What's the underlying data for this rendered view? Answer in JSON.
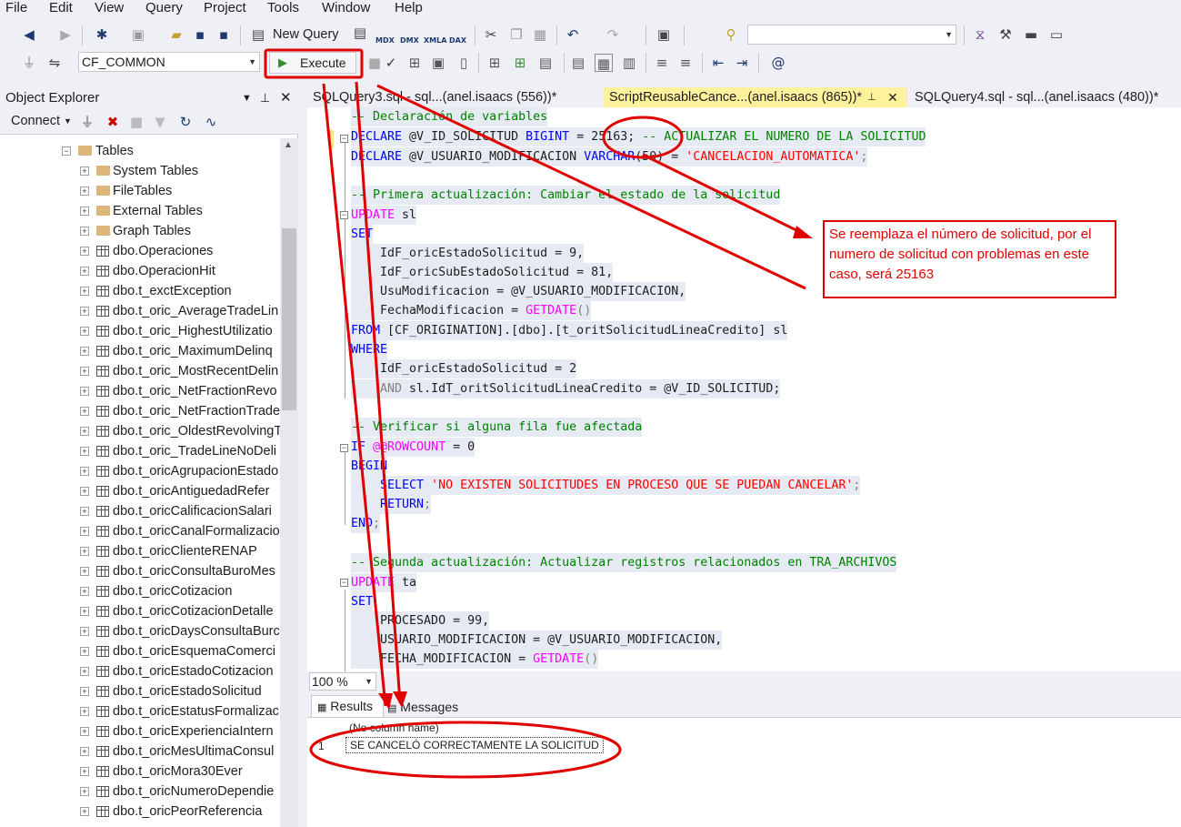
{
  "menu": [
    "File",
    "Edit",
    "View",
    "Query",
    "Project",
    "Tools",
    "Window",
    "Help"
  ],
  "toolbar1": {
    "new_query": "New Query",
    "mdx": "MDX",
    "dmx": "DMX",
    "xmla": "XMLA",
    "dax": "DAX",
    "search_value": ""
  },
  "toolbar2": {
    "database": "CF_COMMON",
    "execute": "Execute"
  },
  "object_explorer": {
    "title": "Object Explorer",
    "connect": "Connect",
    "tables_folder": "Tables",
    "folders": [
      "System Tables",
      "FileTables",
      "External Tables",
      "Graph Tables"
    ],
    "tables": [
      "dbo.Operaciones",
      "dbo.OperacionHit",
      "dbo.t_exctException",
      "dbo.t_oric_AverageTradeLin",
      "dbo.t_oric_HighestUtilizatio",
      "dbo.t_oric_MaximumDelinq",
      "dbo.t_oric_MostRecentDelin",
      "dbo.t_oric_NetFractionRevo",
      "dbo.t_oric_NetFractionTrade",
      "dbo.t_oric_OldestRevolvingT",
      "dbo.t_oric_TradeLineNoDeli",
      "dbo.t_oricAgrupacionEstado",
      "dbo.t_oricAntiguedadRefer",
      "dbo.t_oricCalificacionSalari",
      "dbo.t_oricCanalFormalizacio",
      "dbo.t_oricClienteRENAP",
      "dbo.t_oricConsultaBuroMes",
      "dbo.t_oricCotizacion",
      "dbo.t_oricCotizacionDetalle",
      "dbo.t_oricDaysConsultaBurc",
      "dbo.t_oricEsquemaComerci",
      "dbo.t_oricEstadoCotizacion",
      "dbo.t_oricEstadoSolicitud",
      "dbo.t_oricEstatusFormalizac",
      "dbo.t_oricExperienciaIntern",
      "dbo.t_oricMesUltimaConsul",
      "dbo.t_oricMora30Ever",
      "dbo.t_oricNumeroDependie",
      "dbo.t_oricPeorReferencia"
    ]
  },
  "tabs": [
    {
      "label": "SQLQuery3.sql - sql...(anel.isaacs (556))*"
    },
    {
      "label": "ScriptReusableCance...(anel.isaacs (865))*"
    },
    {
      "label": "SQLQuery4.sql - sql...(anel.isaacs (480))*"
    }
  ],
  "code": {
    "l1": "-- Declaración de variables",
    "l2a": "DECLARE",
    "l2b": " @V_ID_SOLICITUD ",
    "l2c": "BIGINT",
    "l2d": " = 25163; ",
    "l2e": "-- ACTUALIZAR EL NUMERO DE LA SOLICITUD",
    "l3a": "DECLARE",
    "l3b": " @V_USUARIO_MODIFICACION ",
    "l3c": "VARCHAR",
    "l3d": "(50) = ",
    "l3e": "'CANCELACION_AUTOMATICA'",
    "l3f": ";",
    "l4": "-- Primera actualización: Cambiar el estado de la solicitud",
    "l5a": "UPDATE",
    "l5b": " sl",
    "l6": "SET",
    "l7": "    IdF_oricEstadoSolicitud = 9,",
    "l8": "    IdF_oricSubEstadoSolicitud = 81,",
    "l9": "    UsuModificacion = @V_USUARIO_MODIFICACION,",
    "l10a": "    FechaModificacion = ",
    "l10b": "GETDATE",
    "l10c": "()",
    "l11a": "FROM",
    "l11b": " [CF_ORIGINATION].[dbo].[t_oritSolicitudLineaCredito] sl",
    "l12": "WHERE",
    "l13": "    IdF_oricEstadoSolicitud = 2",
    "l14a": "    AND",
    "l14b": " sl.IdT_oritSolicitudLineaCredito = @V_ID_SOLICITUD;",
    "l15": "-- Verificar si alguna fila fue afectada",
    "l16a": "IF",
    "l16b": " @@ROWCOUNT",
    "l16c": " = 0",
    "l17": "BEGIN",
    "l18a": "    SELECT",
    "l18b": " 'NO EXISTEN SOLICITUDES EN PROCESO QUE SE PUEDAN CANCELAR'",
    "l18c": ";",
    "l19a": "    RETURN",
    "l19b": ";",
    "l20a": "END",
    "l20b": ";",
    "l21": "-- Segunda actualización: Actualizar registros relacionados en TRA_ARCHIVOS",
    "l22a": "UPDATE",
    "l22b": " ta",
    "l23": "SET",
    "l24": "    PROCESADO = 99,",
    "l25": "    USUARIO_MODIFICACION = @V_USUARIO_MODIFICACION,",
    "l26a": "    FECHA_MODIFICACION = ",
    "l26b": "GETDATE",
    "l26c": "()"
  },
  "zoom": "100 %",
  "results": {
    "tab_results": "Results",
    "tab_messages": "Messages",
    "column": "(No column name)",
    "row_num": "1",
    "value": "SE CANCELÓ CORRECTAMENTE LA SOLICITUD"
  },
  "annotation": "Se reemplaza el número de solicitud, por el numero de solicitud con problemas en este caso, será 25163",
  "colors": {
    "annotation": "#e00000",
    "active_tab": "#fff29d",
    "keyword": "#0000ff",
    "comment": "#008000",
    "string": "#ff0000"
  }
}
